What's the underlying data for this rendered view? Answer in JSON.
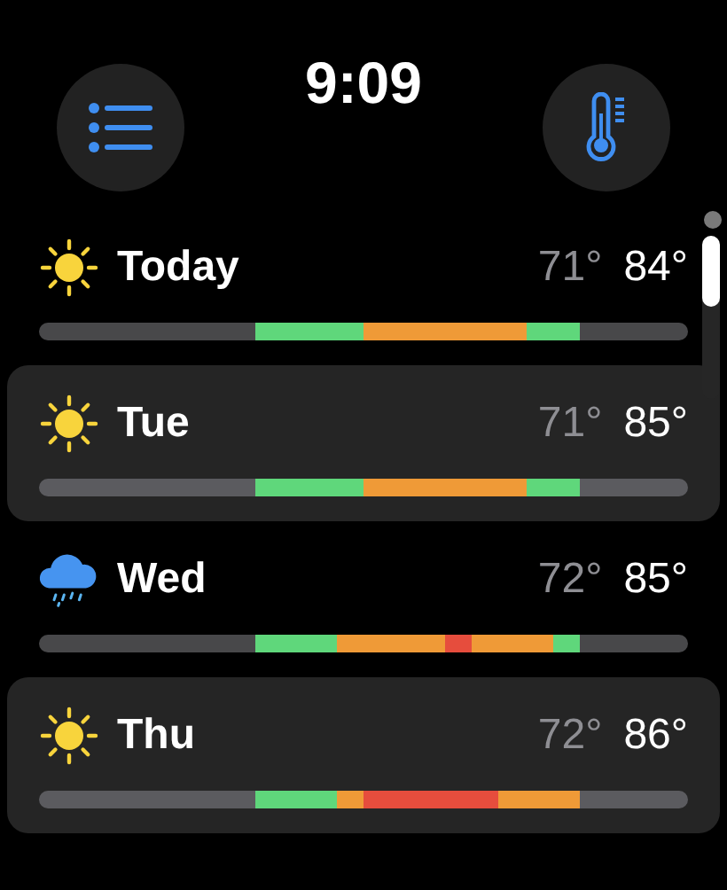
{
  "time": "9:09",
  "days": [
    {
      "name": "Today",
      "kind": "sun",
      "shaded": false,
      "low": "71°",
      "high": "84°",
      "segments": [
        {
          "color": "#5fd77b"
        },
        {
          "color": "#ef9a37"
        },
        {
          "color": "#5fd77b"
        }
      ]
    },
    {
      "name": "Tue",
      "kind": "sun",
      "shaded": true,
      "low": "71°",
      "high": "85°",
      "segments": [
        {
          "color": "#5fd77b"
        },
        {
          "color": "#ef9a37"
        },
        {
          "color": "#5fd77b"
        }
      ]
    },
    {
      "name": "Wed",
      "kind": "rain",
      "shaded": false,
      "low": "72°",
      "high": "85°",
      "segments": [
        {
          "color": "#5fd77b"
        },
        {
          "color": "#ef9a37"
        },
        {
          "color": "#e64d3d"
        },
        {
          "color": "#ef9a37"
        },
        {
          "color": "#5fd77b"
        }
      ]
    },
    {
      "name": "Thu",
      "kind": "sun",
      "shaded": true,
      "low": "72°",
      "high": "86°",
      "segments": [
        {
          "color": "#5fd77b"
        },
        {
          "color": "#ef9a37"
        },
        {
          "color": "#e64d3d"
        },
        {
          "color": "#ef9a37"
        }
      ]
    }
  ]
}
